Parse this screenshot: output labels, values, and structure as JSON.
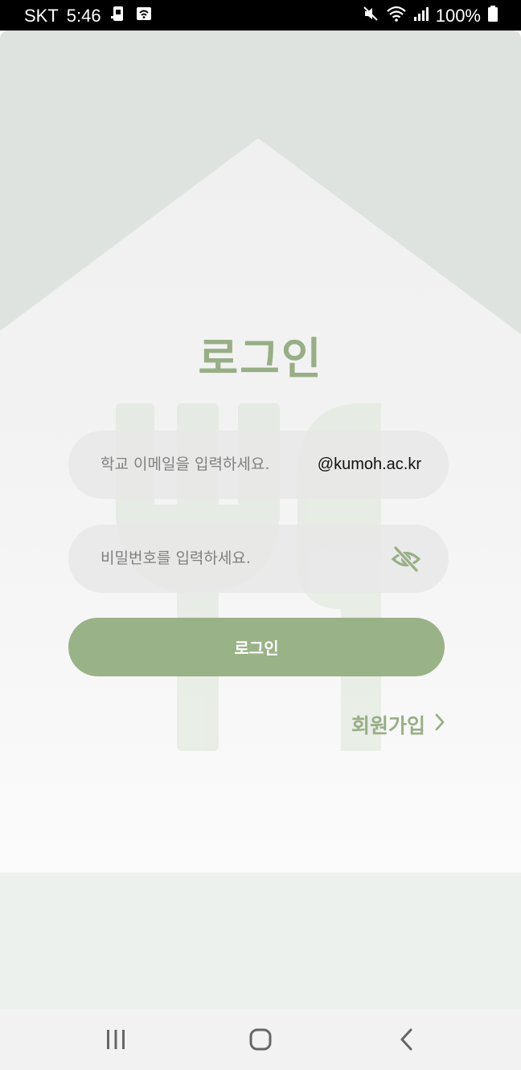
{
  "status_bar": {
    "carrier": "SKT",
    "time": "5:46",
    "battery": "100%",
    "icons": [
      "sim-card-icon",
      "wifi-hotspot-icon",
      "mute-icon",
      "wifi-icon",
      "signal-icon",
      "battery-icon"
    ]
  },
  "login": {
    "title": "로그인",
    "email_placeholder": "학교 이메일을 입력하세요.",
    "email_domain": "@kumoh.ac.kr",
    "password_placeholder": "비밀번호를 입력하세요.",
    "password_toggle_icon": "eye-off-icon",
    "submit_label": "로그인",
    "signup_label": "회원가입",
    "signup_icon": "chevron-right-icon"
  },
  "nav": {
    "icons": [
      "recent-apps-icon",
      "home-icon",
      "back-icon"
    ]
  },
  "colors": {
    "accent": "#98ae87",
    "button": "#9ab287",
    "field": "#e8e8e8",
    "background_shape": "#dfe3df"
  }
}
